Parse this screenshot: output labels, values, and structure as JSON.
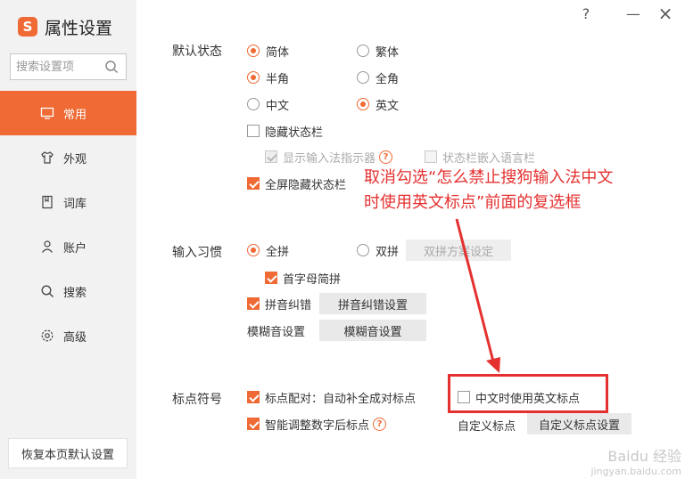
{
  "app": {
    "title": "属性设置",
    "logo_letter": "S",
    "accent": "#f06a35"
  },
  "window_controls": {
    "help": "?",
    "minimize": "—",
    "close": "×"
  },
  "sidebar": {
    "search_placeholder": "搜索设置项",
    "items": [
      {
        "label": "常用",
        "icon": "monitor-icon",
        "active": true
      },
      {
        "label": "外观",
        "icon": "shirt-icon",
        "active": false
      },
      {
        "label": "词库",
        "icon": "book-icon",
        "active": false
      },
      {
        "label": "账户",
        "icon": "user-icon",
        "active": false
      },
      {
        "label": "搜索",
        "icon": "search-icon",
        "active": false
      },
      {
        "label": "高级",
        "icon": "gear-icon",
        "active": false
      }
    ],
    "reset_button": "恢复本页默认设置"
  },
  "default_state": {
    "label": "默认状态",
    "simplified": "简体",
    "traditional": "繁体",
    "half_width": "半角",
    "full_width": "全角",
    "chinese": "中文",
    "english": "英文",
    "hide_status_bar": "隐藏状态栏",
    "show_indicator": "显示输入法指示器",
    "embed_language_bar": "状态栏嵌入语言栏",
    "fullscreen_hide": "全屏隐藏状态栏"
  },
  "input_habit": {
    "label": "输入习惯",
    "quanpin": "全拼",
    "shuangpin": "双拼",
    "shuangpin_settings": "双拼方案设定",
    "initial_abbrev": "首字母简拼",
    "pinyin_correction": "拼音纠错",
    "pinyin_correction_settings": "拼音纠错设置",
    "fuzzy_label": "模糊音设置",
    "fuzzy_button": "模糊音设置"
  },
  "punctuation": {
    "label": "标点符号",
    "pairing": "标点配对：自动补全成对标点",
    "english_punct_in_chinese": "中文时使用英文标点",
    "smart_after_digits": "智能调整数字后标点",
    "custom_label": "自定义标点",
    "custom_button": "自定义标点设置"
  },
  "annotation": {
    "line1": "取消勾选“怎么禁止搜狗输入法中文",
    "line2": "时使用英文标点”前面的复选框",
    "color": "#e53030"
  },
  "watermark": {
    "line1": "Baidu 经验",
    "line2": "jingyan.baidu.com"
  }
}
